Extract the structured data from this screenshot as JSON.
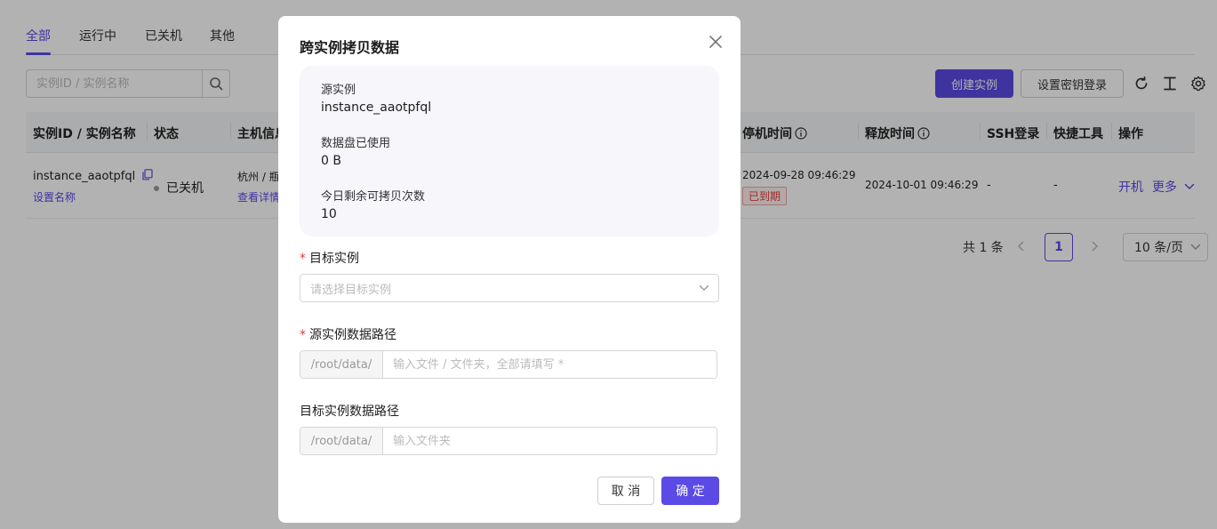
{
  "tabs": [
    {
      "label": "全部"
    },
    {
      "label": "运行中"
    },
    {
      "label": "已关机"
    },
    {
      "label": "其他"
    }
  ],
  "search": {
    "placeholder": "实例ID / 实例名称"
  },
  "toolbar": {
    "create_label": "创建实例",
    "ssh_key_label": "设置密钥登录"
  },
  "table": {
    "headers": {
      "id_name": "实例ID / 实例名称",
      "status": "状态",
      "host": "主机信息",
      "stop_time": "停机时间",
      "release_time": "释放时间",
      "ssh": "SSH登录",
      "tools": "快捷工具",
      "actions": "操作"
    },
    "rows": [
      {
        "instance_id": "instance_aaotpfql",
        "set_name": "设置名称",
        "status": "已关机",
        "host_region": "杭州 / 瓶",
        "host_detail": "查看详情",
        "stop_time": "2024-09-28 09:46:29",
        "stop_tag": "已到期",
        "release_time": "2024-10-01 09:46:29",
        "ssh": "-",
        "tools": "-",
        "action_start": "开机",
        "action_more": "更多"
      }
    ]
  },
  "pagination": {
    "total": "共 1 条",
    "current_page": "1",
    "page_size": "10 条/页"
  },
  "modal": {
    "title": "跨实例拷贝数据",
    "info": {
      "source_label": "源实例",
      "source_value": "instance_aaotpfql",
      "disk_label": "数据盘已使用",
      "disk_value": "0 B",
      "remaining_label": "今日剩余可拷贝次数",
      "remaining_value": "10"
    },
    "target_label": "目标实例",
    "target_placeholder": "请选择目标实例",
    "source_path_label": "源实例数据路径",
    "source_path_prefix": "/root/data/",
    "source_path_placeholder": "输入文件 / 文件夹，全部请填写 *",
    "target_path_label": "目标实例数据路径",
    "target_path_prefix": "/root/data/",
    "target_path_placeholder": "输入文件夹",
    "cancel_label": "取 消",
    "ok_label": "确 定",
    "required_mark": "*"
  },
  "colors": {
    "accent": "#5b4ae6",
    "danger": "#e23c3c",
    "mask": "rgba(0,0,0,0.3)"
  }
}
